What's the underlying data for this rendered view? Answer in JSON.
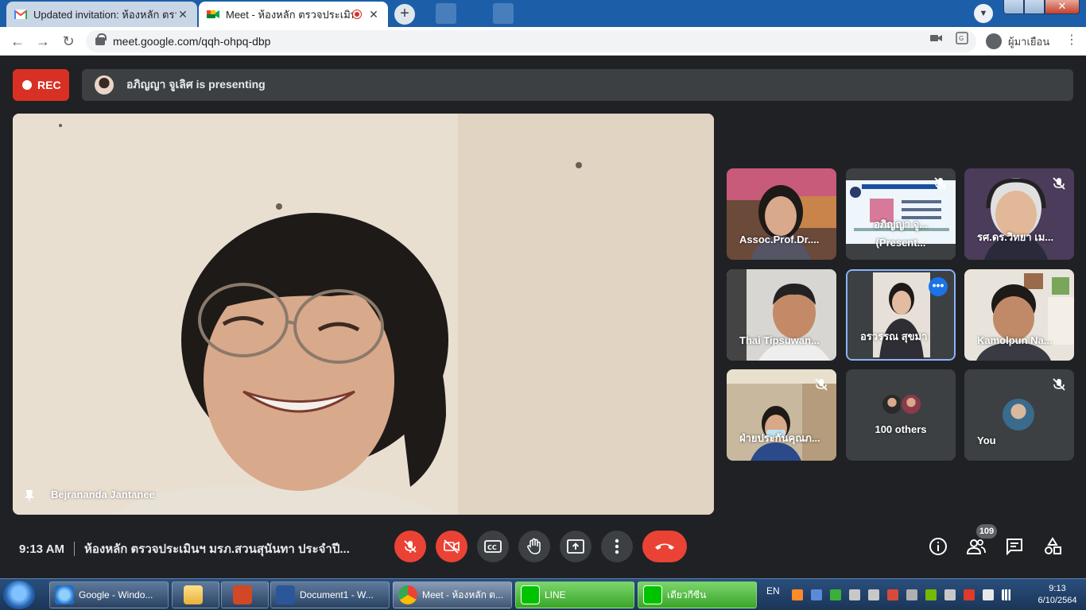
{
  "browser": {
    "tabs": [
      {
        "title": "Updated invitation: ห้องหลัก ตรวจ",
        "favicon": "gmail-icon"
      },
      {
        "title": "Meet - ห้องหลัก ตรวจประเมินฯ",
        "favicon": "meet-icon",
        "recording": true
      }
    ],
    "new_tab": "+",
    "url": "meet.google.com/qqh-ohpq-dbp",
    "profile_name": "ผู้มาเยือน"
  },
  "meet": {
    "rec_label": "REC",
    "presenting_text": "อภิญญา จูเลิศ is presenting",
    "main_speaker": "Bejrananda Jantanee",
    "tiles": [
      {
        "name": "Assoc.Prof.Dr....",
        "muted": false
      },
      {
        "name": "อภิญญา จู...",
        "sub": "(Present...",
        "muted": true
      },
      {
        "name": "รศ.ดร.วิทยา เม...",
        "muted": true
      },
      {
        "name": "Thai Tipsuwan...",
        "muted": false
      },
      {
        "name": "อรวรรณ สุขมา",
        "muted": false,
        "speaking": true
      },
      {
        "name": "Kamolpun Na...",
        "muted": false
      },
      {
        "name": "ฝ่ายประกันคุณภ...",
        "muted": true
      },
      {
        "name": "100 others",
        "muted": false
      },
      {
        "name": "You",
        "muted": true
      }
    ],
    "bottom": {
      "time": "9:13 AM",
      "meeting_title": "ห้องหลัก ตรวจประเมินฯ มรภ.สวนสุนันทา ประจำปี...",
      "participant_count": "109"
    }
  },
  "taskbar": {
    "items": [
      {
        "label": "Google - Windo..."
      },
      {
        "label": ""
      },
      {
        "label": ""
      },
      {
        "label": "Document1 - W..."
      },
      {
        "label": "Meet - ห้องหลัก ต..."
      },
      {
        "label": "LINE"
      },
      {
        "label": "เดียวกีซีน"
      }
    ],
    "lang": "EN",
    "time": "9:13",
    "date": "6/10/2564"
  },
  "colors": {
    "meet_bg": "#202124",
    "tile_bg": "#3c4043",
    "rec_red": "#d93025",
    "hangup_red": "#ea4335",
    "speaking_border": "#8ab4f8"
  }
}
